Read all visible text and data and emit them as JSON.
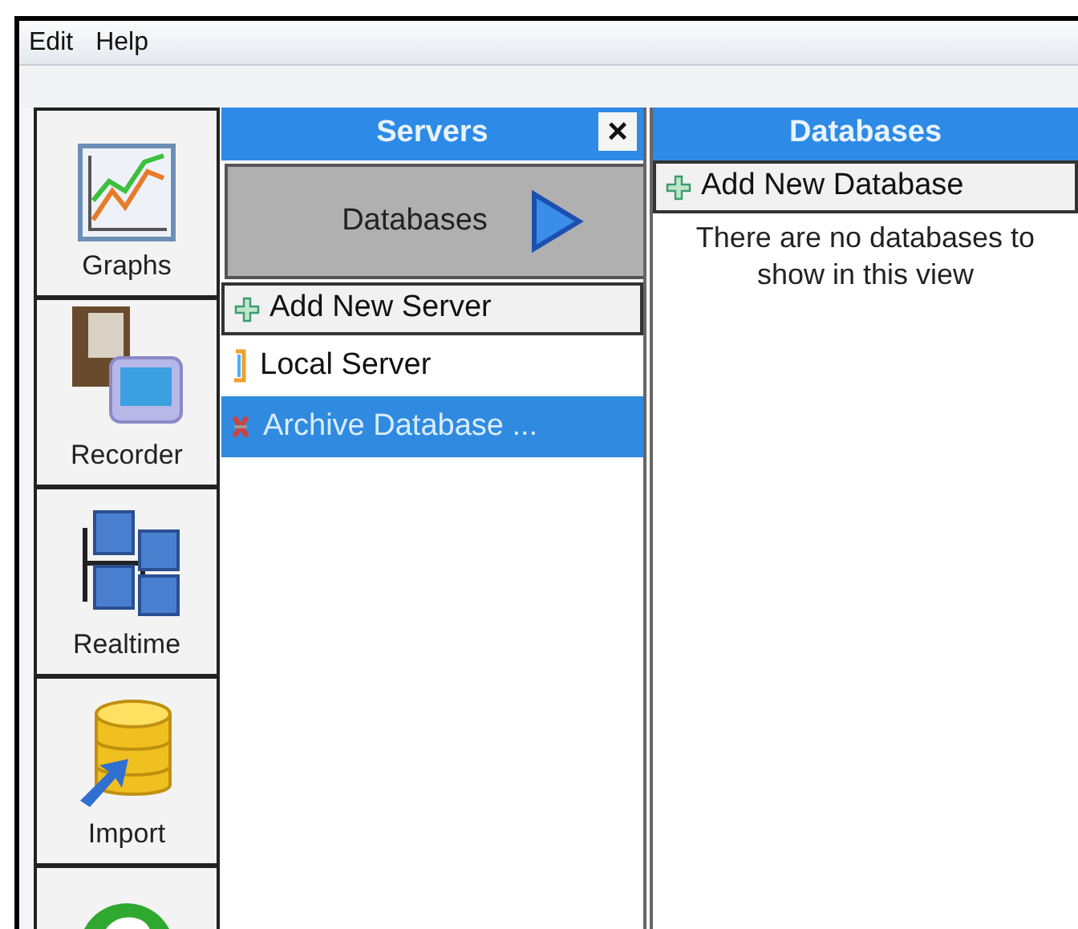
{
  "menu": [
    {
      "label": "Edit"
    },
    {
      "label": "Help"
    }
  ],
  "sidebar": {
    "items": [
      {
        "label": "Graphs"
      },
      {
        "label": "Recorder"
      },
      {
        "label": "Realtime"
      },
      {
        "label": "Import"
      }
    ]
  },
  "servers": {
    "title": "Servers",
    "close": "×",
    "databases_button": "Databases",
    "add_button": "Add New Server",
    "items": [
      {
        "label": "Local Server",
        "selected": false
      },
      {
        "label": "Archive Database ...",
        "selected": true
      }
    ]
  },
  "databases": {
    "title": "Databases",
    "add_button": "Add New Database",
    "empty_message": "There are no databases to show in this view"
  }
}
